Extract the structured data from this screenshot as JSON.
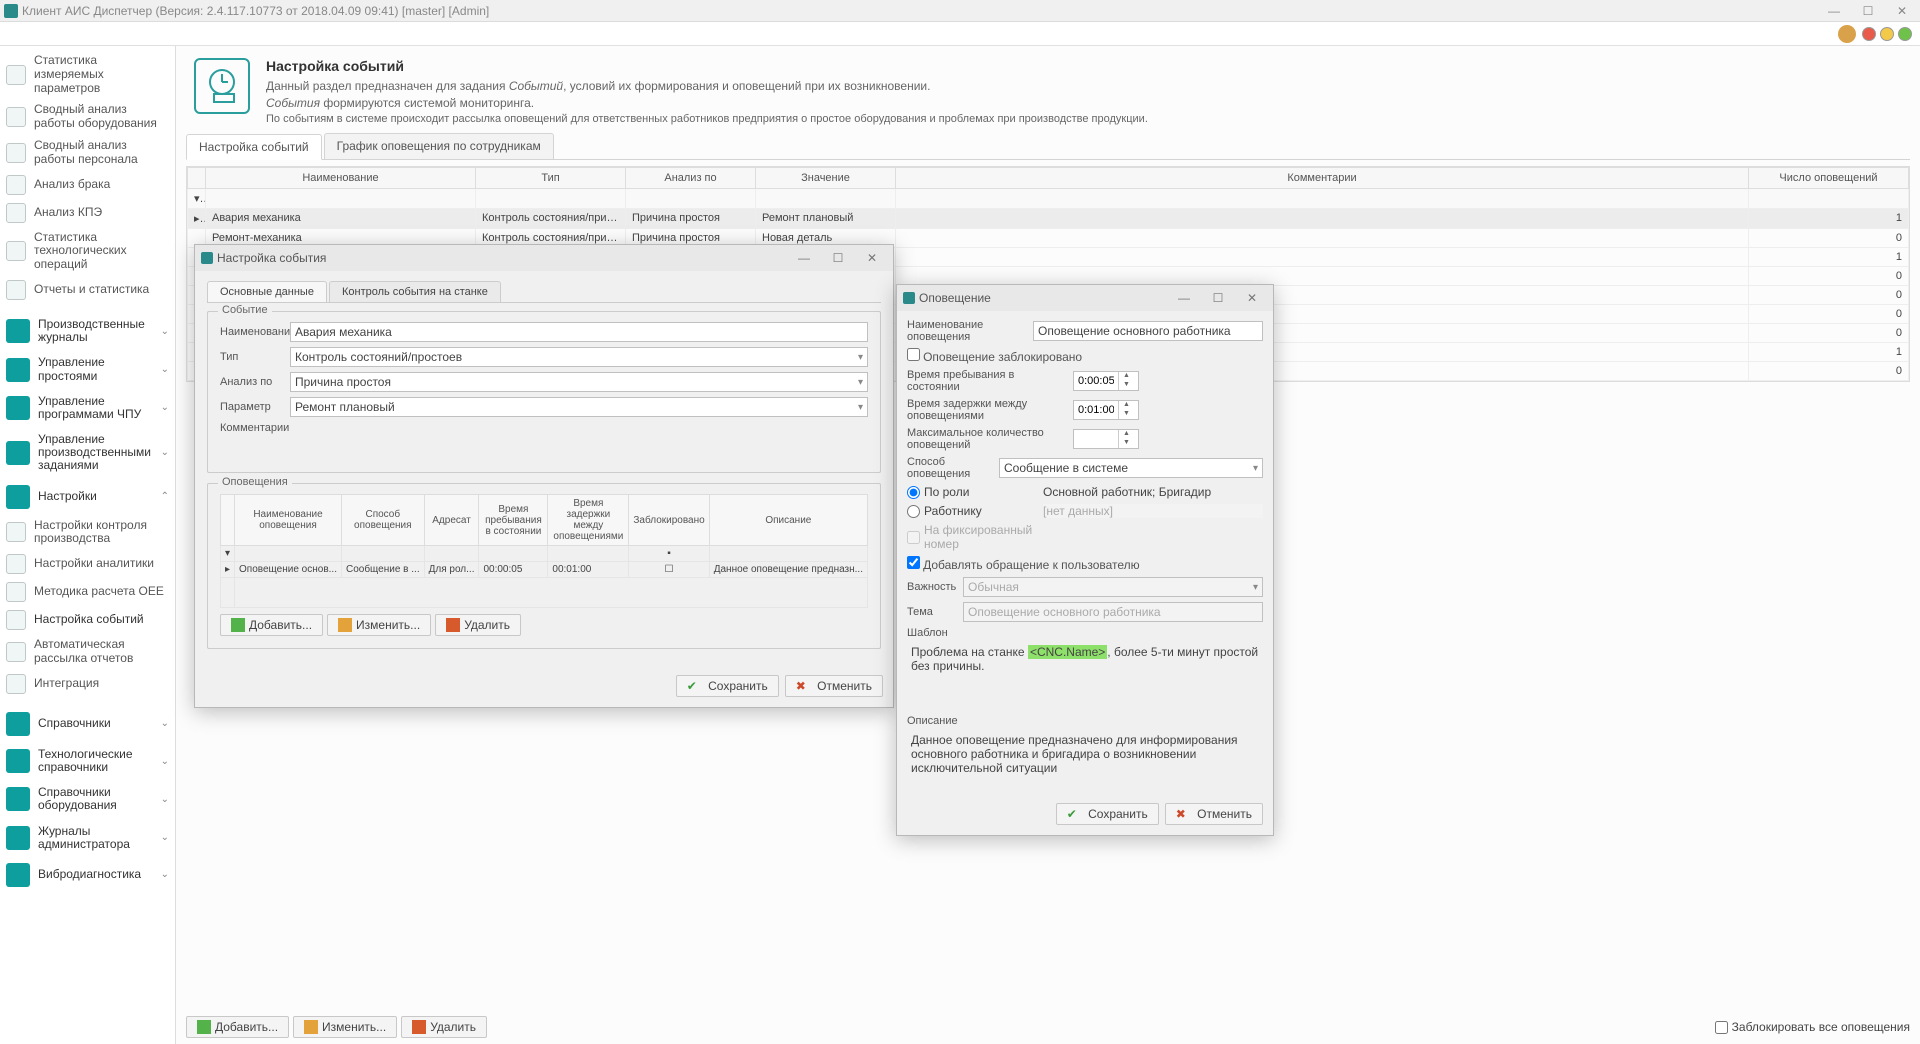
{
  "window": {
    "title": "Клиент АИС Диспетчер (Версия: 2.4.117.10773 от 2018.04.09 09:41) [master]  [Admin]"
  },
  "sidebar": {
    "items": [
      "Статистика измеряемых параметров",
      "Сводный анализ работы оборудования",
      "Сводный анализ работы персонала",
      "Анализ брака",
      "Анализ КПЭ",
      "Статистика технологических операций",
      "Отчеты и статистика"
    ],
    "groups": [
      "Производственные журналы",
      "Управление простоями",
      "Управление программами ЧПУ",
      "Управление производственными заданиями",
      "Настройки"
    ],
    "settings_items": [
      "Настройки контроля производства",
      "Настройки аналитики",
      "Методика расчета OEE",
      "Настройка событий",
      "Автоматическая рассылка отчетов",
      "Интеграция"
    ],
    "bottom_groups": [
      "Справочники",
      "Технологические справочники",
      "Справочники оборудования",
      "Журналы администратора",
      "Вибродиагностика"
    ]
  },
  "header": {
    "title": "Настройка событий",
    "line1a": "Данный раздел предназначен для задания ",
    "line1b": "Событий",
    "line1c": ", условий их формирования и оповещений при их возникновении.",
    "line2a": "События",
    "line2b": " формируются системой мониторинга.",
    "line3": "По событиям в системе происходит рассылка оповещений для ответственных работников предприятия о простое оборудования и проблемах при производстве продукции."
  },
  "tabs": {
    "t1": "Настройка событий",
    "t2": "График оповещения по сотрудникам"
  },
  "main_grid": {
    "cols": [
      "Наименование",
      "Тип",
      "Анализ по",
      "Значение",
      "Комментарии",
      "Число оповещений"
    ],
    "rows": [
      [
        "Авария механика",
        "Контроль состояния/причины п...",
        "Причина простоя",
        "Ремонт плановый",
        "",
        "1"
      ],
      [
        "Ремонт-механика",
        "Контроль состояния/причины п...",
        "Причина простоя",
        "Новая деталь",
        "",
        "0"
      ],
      [
        "",
        "",
        "",
        "",
        "",
        "1"
      ],
      [
        "",
        "",
        "",
        "",
        "",
        "0"
      ],
      [
        "",
        "",
        "",
        "",
        "",
        "0"
      ],
      [
        "",
        "",
        "",
        "",
        "",
        "0"
      ],
      [
        "",
        "",
        "",
        "",
        "",
        "0"
      ],
      [
        "",
        "",
        "",
        "",
        "",
        "1"
      ],
      [
        "",
        "",
        "",
        "",
        "",
        "0"
      ]
    ]
  },
  "buttons": {
    "add": "Добавить...",
    "edit": "Изменить...",
    "del": "Удалить",
    "save": "Сохранить",
    "cancel": "Отменить"
  },
  "block_all": "Заблокировать все оповещения",
  "dlg1": {
    "title": "Настройка события",
    "tabs": {
      "t1": "Основные данные",
      "t2": "Контроль события на станке"
    },
    "group1": "Событие",
    "labels": {
      "name": "Наименование",
      "type": "Тип",
      "analysis": "Анализ по",
      "param": "Параметр",
      "comment": "Комментарии"
    },
    "vals": {
      "name": "Авария механика",
      "type": "Контроль состояний/простоев",
      "analysis": "Причина простоя",
      "param": "Ремонт плановый"
    },
    "group2": "Оповещения",
    "inner_cols": [
      "Наименование оповещения",
      "Способ оповещения",
      "Адресат",
      "Время пребывания в состоянии",
      "Время задержки между оповещениями",
      "Заблокировано",
      "Описание"
    ],
    "inner_row": [
      "Оповещение основ...",
      "Сообщение в ...",
      "Для рол...",
      "00:00:05",
      "00:01:00",
      "",
      "Данное оповещение предназн..."
    ]
  },
  "dlg2": {
    "title": "Оповещение",
    "labels": {
      "name": "Наименование оповещения",
      "blocked": "Оповещение заблокировано",
      "stay": "Время пребывания в состоянии",
      "delay": "Время задержки между оповещениями",
      "max": "Максимальное количество оповещений",
      "method": "Способ оповещения",
      "byrole": "По роли",
      "worker": "Работнику",
      "fixednum": "На фиксированный номер",
      "personal": "Добавлять обращение к пользователю",
      "importance": "Важность",
      "subject": "Тема",
      "template": "Шаблон",
      "desc": "Описание"
    },
    "vals": {
      "name": "Оповещение основного работника",
      "stay": "0:00:05",
      "delay": "0:01:00",
      "max": "",
      "method": "Сообщение в системе",
      "role": "Основной работник; Бригадир",
      "worker": "[нет данных]",
      "importance": "Обычная",
      "subject": "Оповещение основного работника",
      "tmpl_pre": "Проблема на станке ",
      "tmpl_tag": "<CNC.Name>",
      "tmpl_post": ", более 5-ти минут простой без причины.",
      "desc": "Данное оповещение предназначено для информирования основного работника и бригадира о возникновении исключительной ситуации"
    }
  }
}
